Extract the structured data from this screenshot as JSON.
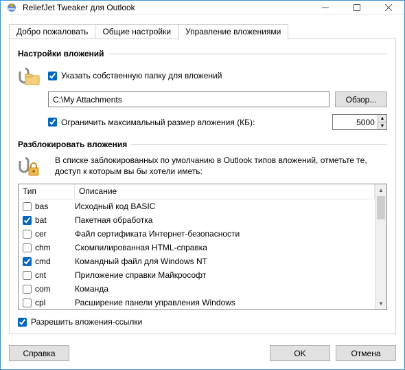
{
  "window": {
    "title": "ReliefJet Tweaker для Outlook"
  },
  "tabs": [
    {
      "label": "Добро пожаловать",
      "active": false
    },
    {
      "label": "Общие настройки",
      "active": false
    },
    {
      "label": "Управление вложениями",
      "active": true
    }
  ],
  "attachments_group": {
    "heading": "Настройки вложений",
    "custom_folder_cb": {
      "label": "Указать собственную папку для вложений",
      "checked": true
    },
    "folder_path": "C:\\My Attachments",
    "browse_btn": "Обзор...",
    "limit_size_cb": {
      "label": "Ограничить максимальный размер вложения (КБ):",
      "checked": true
    },
    "limit_size_value": "5000"
  },
  "unblock_group": {
    "heading": "Разблокировать вложения",
    "description": "В списке заблокированных по умолчанию в Outlook типов вложений, отметьте те, доступ к которым вы бы хотели иметь:",
    "columns": {
      "type": "Тип",
      "desc": "Описание"
    },
    "rows": [
      {
        "ext": "bas",
        "desc": "Исходный код BASIC",
        "checked": false
      },
      {
        "ext": "bat",
        "desc": "Пакетная обработка",
        "checked": true
      },
      {
        "ext": "cer",
        "desc": "Файл сертификата Интернет-безопасности",
        "checked": false
      },
      {
        "ext": "chm",
        "desc": "Скомпилированная HTML-справка",
        "checked": false
      },
      {
        "ext": "cmd",
        "desc": "Командный файл для Windows NT",
        "checked": true
      },
      {
        "ext": "cnt",
        "desc": "Приложение справки Майкрософт",
        "checked": false
      },
      {
        "ext": "com",
        "desc": "Команда",
        "checked": false
      },
      {
        "ext": "cpl",
        "desc": "Расширение панели управления Windows",
        "checked": false
      }
    ]
  },
  "allow_links_cb": {
    "label": "Разрешить вложения-ссылки",
    "checked": true
  },
  "footer": {
    "help": "Справка",
    "ok": "OK",
    "cancel": "Отмена"
  }
}
